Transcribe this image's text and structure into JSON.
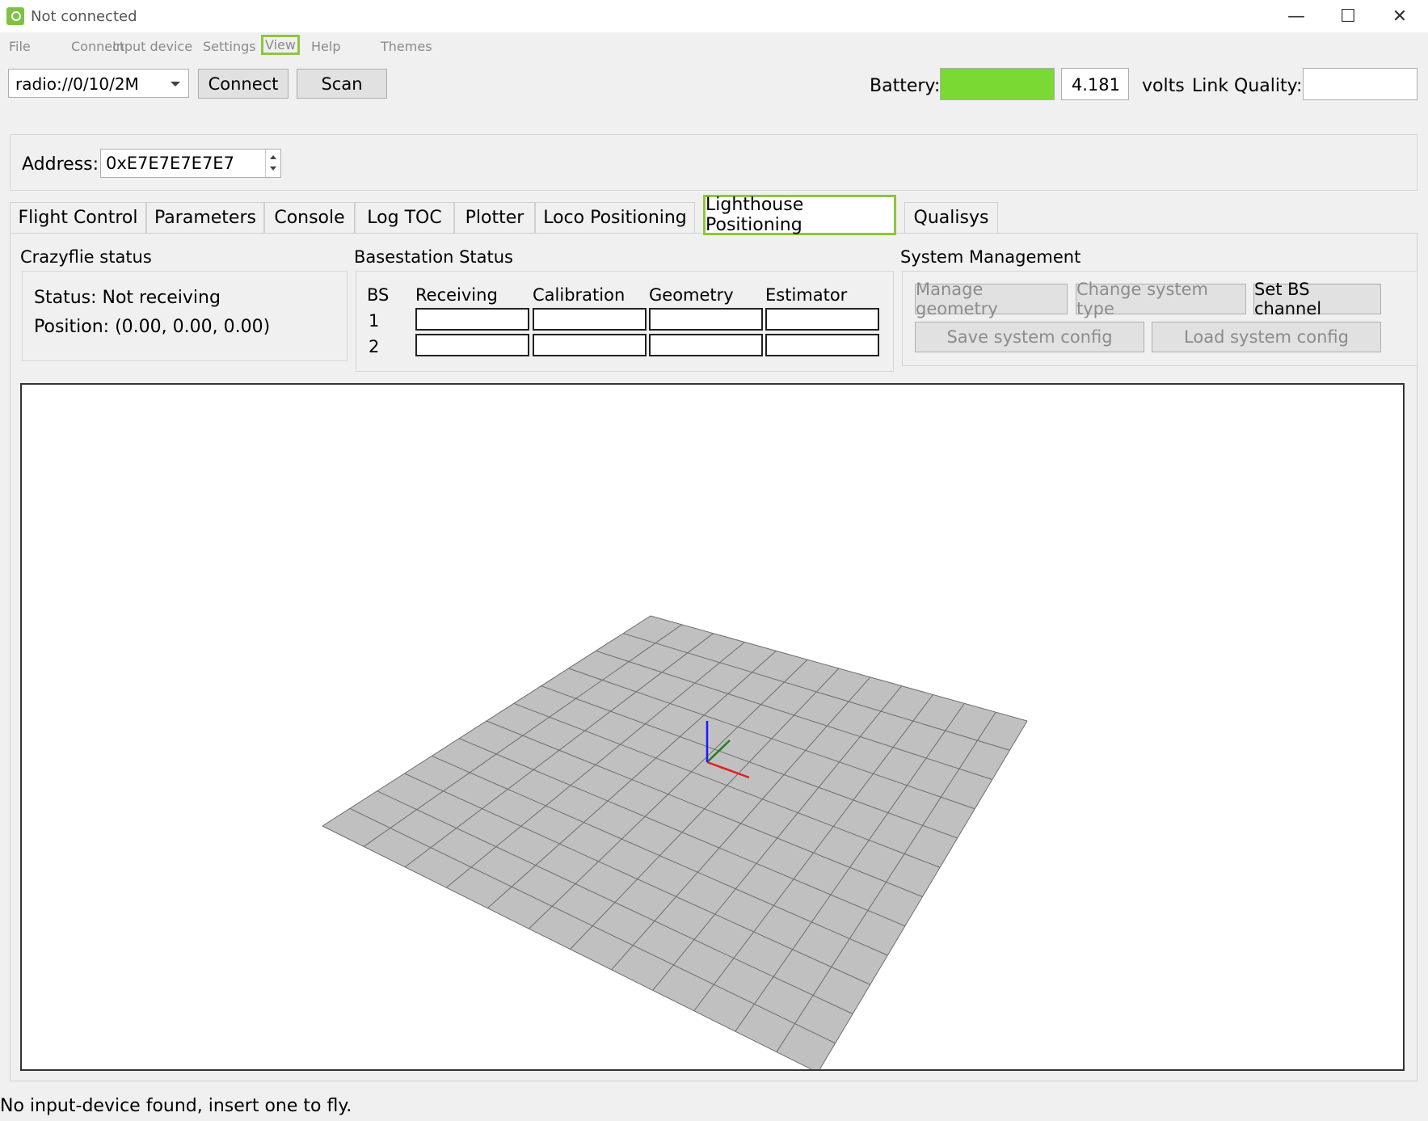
{
  "window": {
    "title": "Not connected"
  },
  "menu": [
    "File",
    "Connect",
    "Input device",
    "Settings",
    "View",
    "Help",
    "Themes"
  ],
  "toolbar": {
    "uri": "radio://0/10/2M",
    "connect_label": "Connect",
    "scan_label": "Scan",
    "battery_label": "Battery:",
    "battery_level": 1.0,
    "battery_voltage": "4.181",
    "volts_label": "volts",
    "link_quality_label": "Link Quality:",
    "link_quality_value": ""
  },
  "address": {
    "label": "Address:",
    "value": "0xE7E7E7E7E7"
  },
  "tabs": [
    "Flight Control",
    "Parameters",
    "Console",
    "Log TOC",
    "Plotter",
    "Loco Positioning",
    "Lighthouse Positioning",
    "Qualisys"
  ],
  "active_tab": "Lighthouse Positioning",
  "crazyflie_status": {
    "title": "Crazyflie status",
    "status": "Status: Not receiving",
    "position": "Position: (0.00, 0.00, 0.00)"
  },
  "basestation": {
    "title": "Basestation Status",
    "columns": [
      "BS",
      "Receiving",
      "Calibration",
      "Geometry",
      "Estimator"
    ],
    "rows": [
      "1",
      "2"
    ]
  },
  "system_management": {
    "title": "System Management",
    "manage_geometry": "Manage geometry",
    "change_system_type": "Change system type",
    "set_bs_channel": "Set BS channel",
    "save_config": "Save system config",
    "load_config": "Load system config"
  },
  "status_bar": "No input-device found, insert one to fly.",
  "colors": {
    "accent": "#8dc63f",
    "battery": "#7ad932",
    "grid_floor": "#c0c0c0",
    "axis_x": "#e02020",
    "axis_y": "#208020",
    "axis_z": "#1a1aff"
  }
}
